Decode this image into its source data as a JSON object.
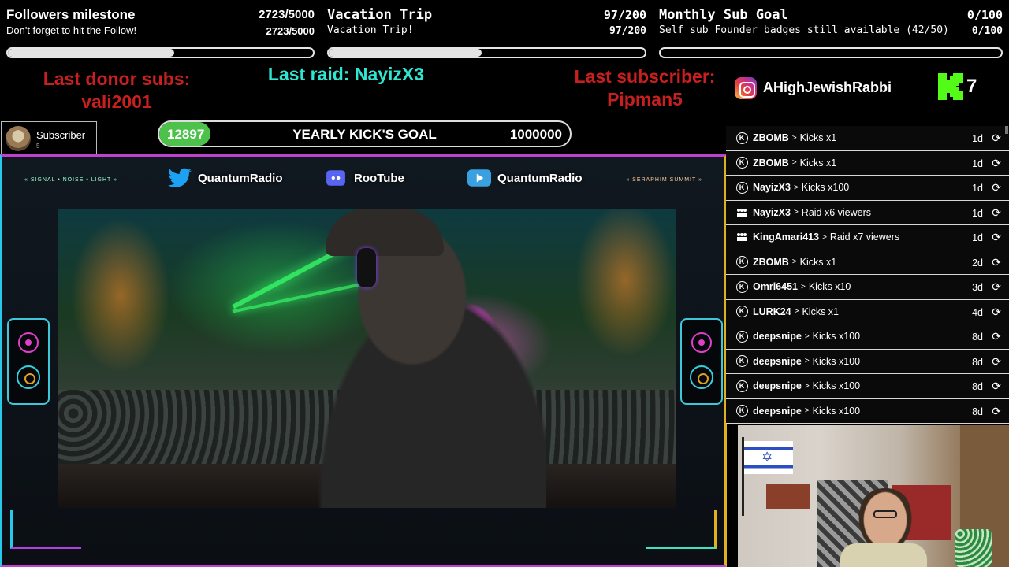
{
  "goals": [
    {
      "title": "Followers milestone",
      "count": "2723/5000",
      "subtitle": "Don't forget to hit the Follow!",
      "count2": "2723/5000",
      "progress": 0.5446
    },
    {
      "title": "Vacation Trip",
      "count": "97/200",
      "subtitle": "Vacation Trip!",
      "count2": "97/200",
      "progress": 0.485
    },
    {
      "title": "Monthly Sub Goal",
      "count": "0/100",
      "subtitle": "Self sub Founder badges still available (42/50)",
      "count2": "0/100",
      "progress": 0.0
    }
  ],
  "last_donor": {
    "label": "Last donor subs:",
    "value": "vali2001"
  },
  "last_raid": {
    "label": "Last raid: NayizX3"
  },
  "last_subscriber": {
    "label": "Last subscriber:",
    "value": "Pipman5"
  },
  "socials": {
    "instagram_handle": "AHighJewishRabbi",
    "kick_count": "7"
  },
  "subscriber_chip": {
    "label": "Subscriber",
    "level": "5"
  },
  "yearly_goal": {
    "current": "12897",
    "title": "YEARLY KICK'S GOAL",
    "target": "1000000",
    "progress": 0.0129
  },
  "stream_overlay": {
    "twitter": "QuantumRadio",
    "discord": "RooTube",
    "youtube": "QuantumRadio",
    "hud_left": "« SIGNAL • NOISE • LIGHT »",
    "hud_right": "« SERAPHIM SUMMIT »"
  },
  "events": [
    {
      "icon": "kick",
      "user": "ZBOMB",
      "action": "Kicks x1",
      "age": "1d"
    },
    {
      "icon": "kick",
      "user": "ZBOMB",
      "action": "Kicks x1",
      "age": "1d"
    },
    {
      "icon": "kick",
      "user": "NayizX3",
      "action": "Kicks x100",
      "age": "1d"
    },
    {
      "icon": "raid",
      "user": "NayizX3",
      "action": "Raid x6 viewers",
      "age": "1d"
    },
    {
      "icon": "raid",
      "user": "KingAmari413",
      "action": "Raid x7 viewers",
      "age": "1d"
    },
    {
      "icon": "kick",
      "user": "ZBOMB",
      "action": "Kicks x1",
      "age": "2d"
    },
    {
      "icon": "kick",
      "user": "Omri6451",
      "action": "Kicks x10",
      "age": "3d"
    },
    {
      "icon": "kick",
      "user": "LURK24",
      "action": "Kicks x1",
      "age": "4d"
    },
    {
      "icon": "kick",
      "user": "deepsnipe",
      "action": "Kicks x100",
      "age": "8d"
    },
    {
      "icon": "kick",
      "user": "deepsnipe",
      "action": "Kicks x100",
      "age": "8d"
    },
    {
      "icon": "kick",
      "user": "deepsnipe",
      "action": "Kicks x100",
      "age": "8d"
    },
    {
      "icon": "kick",
      "user": "deepsnipe",
      "action": "Kicks x100",
      "age": "8d"
    }
  ],
  "colors": {
    "donor_label": "#c81f1f",
    "raid_label": "#2ee6d2",
    "kick_green": "#53fc18",
    "yearly_fill": "#4cc24a"
  }
}
